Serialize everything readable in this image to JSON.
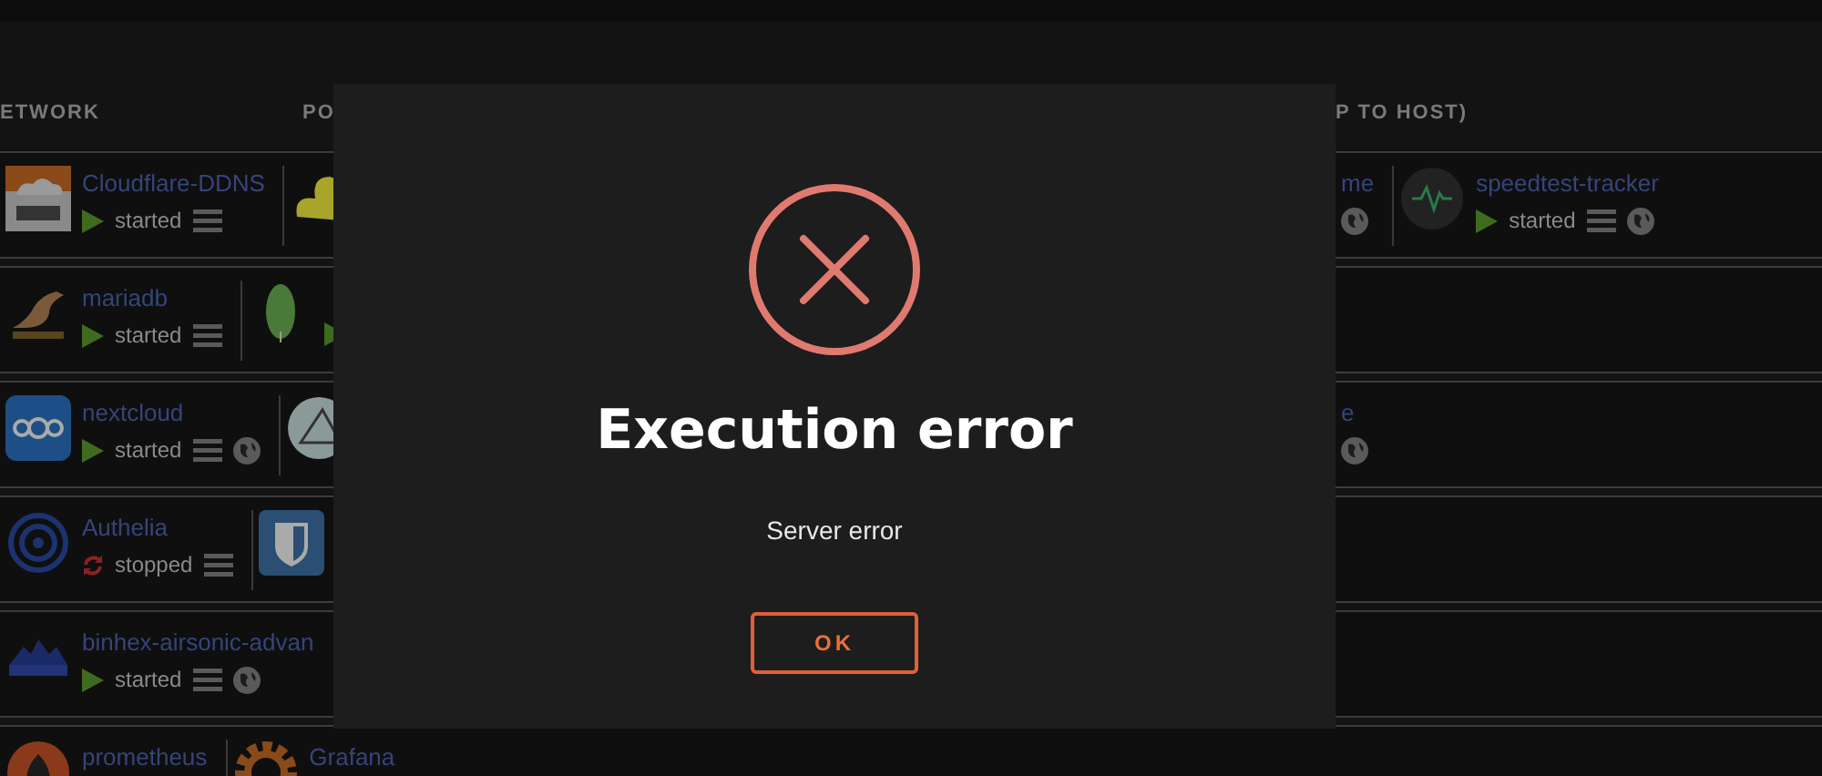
{
  "header": {
    "columns": [
      "ETWORK",
      "PO",
      "P TO HOST)"
    ]
  },
  "rows": [
    {
      "left": [
        {
          "kind": "cf",
          "name": "Cloudflare-DDNS",
          "status": "started",
          "running": true,
          "menu": true,
          "globe": false
        },
        {
          "kind": "duck"
        }
      ],
      "right": [
        {
          "name": "me",
          "globe": true
        },
        {
          "kind": "pulse",
          "name": "speedtest-tracker",
          "status": "started",
          "running": true,
          "menu": true,
          "globe": true
        }
      ]
    },
    {
      "left": [
        {
          "kind": "seal",
          "name": "mariadb",
          "status": "started",
          "running": true,
          "menu": true,
          "globe": false
        },
        {
          "kind": "leaf",
          "running": true
        }
      ],
      "right": []
    },
    {
      "left": [
        {
          "kind": "rings",
          "name": "nextcloud",
          "status": "started",
          "running": true,
          "menu": true,
          "globe": true
        },
        {
          "kind": "triangle"
        }
      ],
      "right": [
        {
          "name": "e",
          "globe": true
        }
      ]
    },
    {
      "left": [
        {
          "kind": "target",
          "name": "Authelia",
          "status": "stopped",
          "running": false,
          "menu": true,
          "globe": false
        },
        {
          "kind": "shield"
        }
      ],
      "right": []
    },
    {
      "left": [
        {
          "kind": "wave",
          "name": "binhex-airsonic-advan",
          "status": "started",
          "running": true,
          "menu": true,
          "globe": true
        }
      ],
      "right": []
    },
    {
      "left": [
        {
          "kind": "flame",
          "name": "prometheus"
        },
        {
          "kind": "gear",
          "name": "Grafana"
        }
      ],
      "right": []
    }
  ],
  "dialog": {
    "kind": "error",
    "title": "Execution error",
    "message": "Server error",
    "button": "OK"
  }
}
